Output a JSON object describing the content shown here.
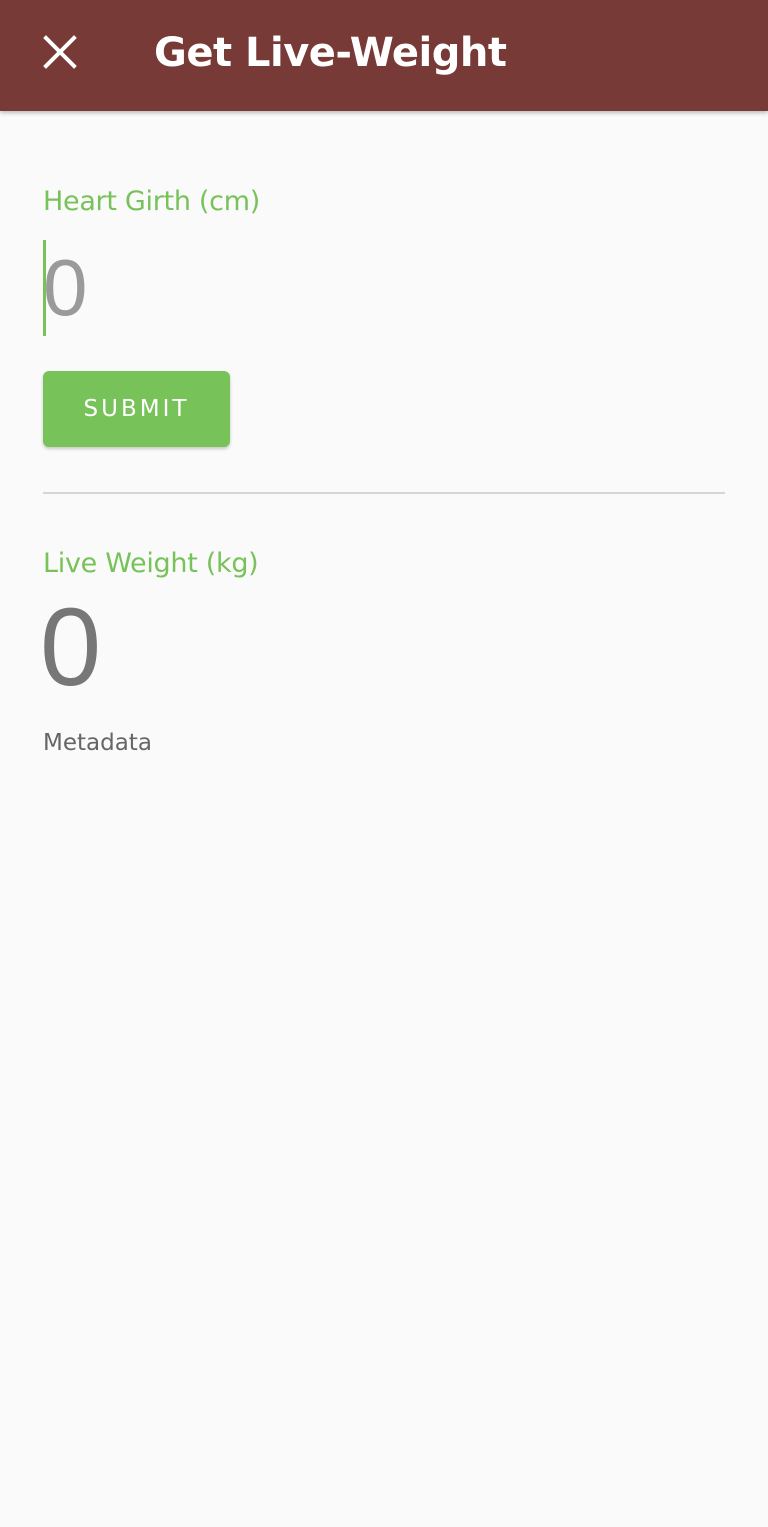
{
  "appbar": {
    "title": "Get Live-Weight",
    "close_icon": "close-icon",
    "color": "#773a36"
  },
  "form": {
    "heart_girth_label": "Heart Girth (cm)",
    "heart_girth_value": "",
    "heart_girth_placeholder": "0",
    "submit_label": "SUBMIT"
  },
  "result": {
    "live_weight_label": "Live Weight (kg)",
    "live_weight_value": "0",
    "metadata_label": "Metadata"
  },
  "accent": "#78c25a"
}
